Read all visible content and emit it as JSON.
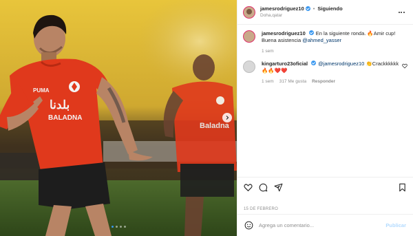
{
  "post": {
    "author": "jamesrodriguez10",
    "follow_label": "Siguiendo",
    "separator": "•",
    "location": "Doha,qatar",
    "carousel_dots": 4,
    "active_dot": 0
  },
  "comments": [
    {
      "username": "jamesrodriguez10",
      "verified": true,
      "segments": [
        {
          "type": "text",
          "value": "En la siguiente ronda. "
        },
        {
          "type": "emoji",
          "value": "🔥"
        },
        {
          "type": "text",
          "value": "Amir cup! Buena asistencia "
        },
        {
          "type": "mention",
          "value": "@ahmed_yasser"
        }
      ],
      "time": "1 sem",
      "likes": "",
      "reply": ""
    },
    {
      "username": "kingarturo23oficial",
      "verified": true,
      "segments": [
        {
          "type": "mention",
          "value": "@jamesrodriguez10"
        },
        {
          "type": "text",
          "value": " "
        },
        {
          "type": "emoji",
          "value": "👏"
        },
        {
          "type": "text",
          "value": "Crackkkkkk "
        },
        {
          "type": "emoji",
          "value": "🔥🔥❤️❤️"
        }
      ],
      "time": "1 sem",
      "likes": "317 Me gusta",
      "reply": "Responder"
    }
  ],
  "date": "15 DE FEBRERO",
  "composer": {
    "placeholder": "Agrega un comentario...",
    "post_label": "Publicar"
  },
  "colors": {
    "accent": "#3897f0",
    "mention": "#00376b",
    "muted": "#8e8e8e",
    "jersey": "#e0391c"
  },
  "icons": [
    "heart-icon",
    "comment-icon",
    "share-icon",
    "bookmark-icon",
    "emoji-icon",
    "more-icon",
    "chevron-right-icon",
    "verified-icon"
  ]
}
